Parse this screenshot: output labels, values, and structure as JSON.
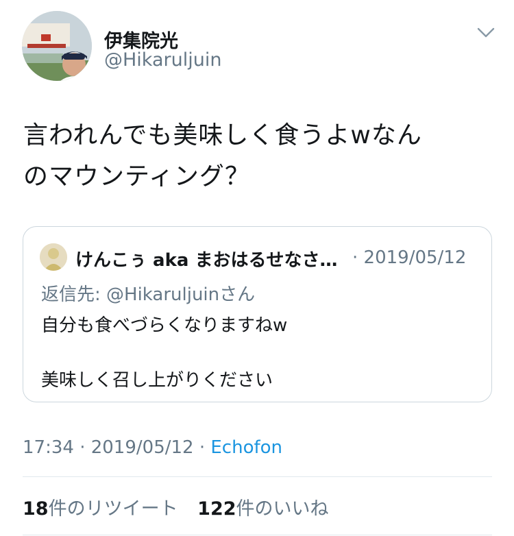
{
  "tweet": {
    "author_name": "伊集院光",
    "author_handle": "@Hikaruljuin",
    "text_line1": "言われんでも美味しく食うよwなん",
    "text_line2": "のマウンティング？",
    "timestamp": "17:34 · 2019/05/12 · ",
    "source": "Echofon"
  },
  "quote": {
    "author_name": "けんこぅ aka まおはるせなさ…",
    "meta": "· 2019/05/12",
    "reply_prefix": "返信先: ",
    "reply_mention": "@Hikaruljuin",
    "reply_suffix": "さん",
    "line1": "自分も食べづらくなりますねw",
    "line2": "美味しく召し上がりください"
  },
  "stats": {
    "retweets_count": "18",
    "retweets_label": "件のリツイート",
    "likes_count": "122",
    "likes_label": "件のいいね"
  },
  "icons": {
    "menu": "chevron-down-icon"
  },
  "colors": {
    "text": "#14171a",
    "secondary": "#657786",
    "link": "#1b95e0",
    "border": "#ccd6dd"
  }
}
